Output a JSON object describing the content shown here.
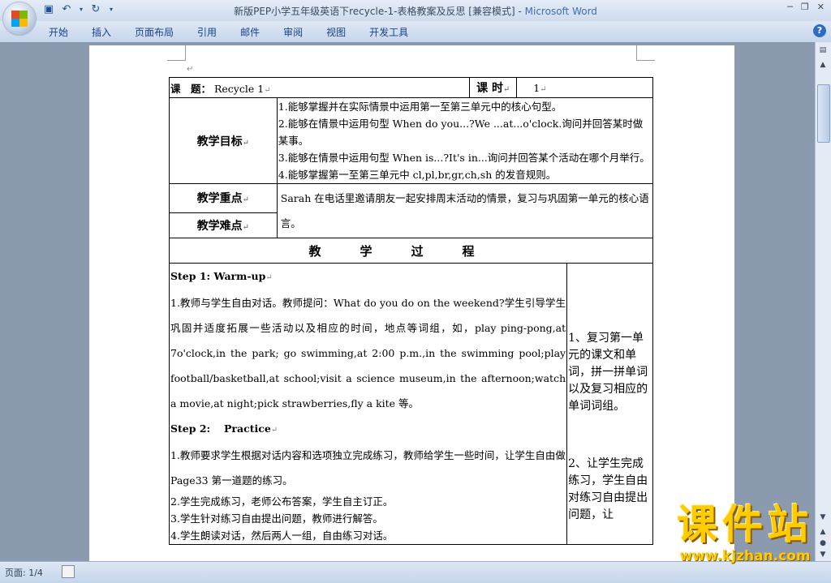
{
  "window": {
    "title": "新版PEP小学五年级英语下recycle-1-表格教案及反思 [兼容模式] - ",
    "app_name": "Microsoft Word"
  },
  "ribbon": {
    "tabs": [
      "开始",
      "插入",
      "页面布局",
      "引用",
      "邮件",
      "审阅",
      "视图",
      "开发工具"
    ]
  },
  "doc": {
    "topic_label": "课　题：",
    "topic_value": "Recycle 1",
    "period_label": "课 时",
    "period_value": "1",
    "objectives_label": "教学目标",
    "objectives": [
      "1.能够掌握并在实际情景中运用第一至第三单元中的核心句型。",
      "2.能够在情景中运用句型 When do you...?We ...at...o'clock.询问并回答某时做某事。",
      "3.能够在情景中运用句型 When is...?It's in...询问并回答某个活动在哪个月举行。",
      "4.能够掌握第一至第三单元中 cl,pl,br,gr,ch,sh 的发音规则。"
    ],
    "key_points_label": "教学重点",
    "difficult_points_label": "教学难点",
    "key_points_text": "Sarah 在电话里邀请朋友一起安排周末活动的情景，复习与巩固第一单元的核心语言。",
    "process_label": "教学过程",
    "step1_title": "Step 1: Warm-up",
    "step1_text": "1.教师与学生自由对话。教师提问：What do you do on the weekend?学生引导学生巩固并适度拓展一些活动以及相应的时间，地点等词组，如，play ping-pong,at 7o'clock,in the park; go swimming,at 2:00 p.m.,in the swimming pool;play football/basketball,at school;visit a science museum,in the afternoon;watch a movie,at night;pick strawberries,fly a kite 等。",
    "step2_title": "Step 2:　 Practice",
    "step2_lines": [
      "1.教师要求学生根据对话内容和选项独立完成练习，教师给学生一些时间，让学生自由做 Page33 第一道题的练习。",
      "2.学生完成练习，老师公布答案，学生自主订正。",
      "3.学生针对练习自由提出问题，教师进行解答。",
      "4.学生朗读对话，然后两人一组，自由练习对话。"
    ],
    "note1": "1、复习第一单元的课文和单词，拼一拼单词以及复习相应的单词词组。",
    "note2": "2、让学生完成练习，学生自由对练习自由提出问题，让"
  },
  "status": {
    "page": "页面: 1/4"
  },
  "watermark": {
    "main": "课件站",
    "url": "www.kjzhan.com"
  },
  "colors": {
    "ribbon": "#dfe8f5",
    "workspace": "#8c9ab0",
    "watermark": "#ffcc00"
  }
}
